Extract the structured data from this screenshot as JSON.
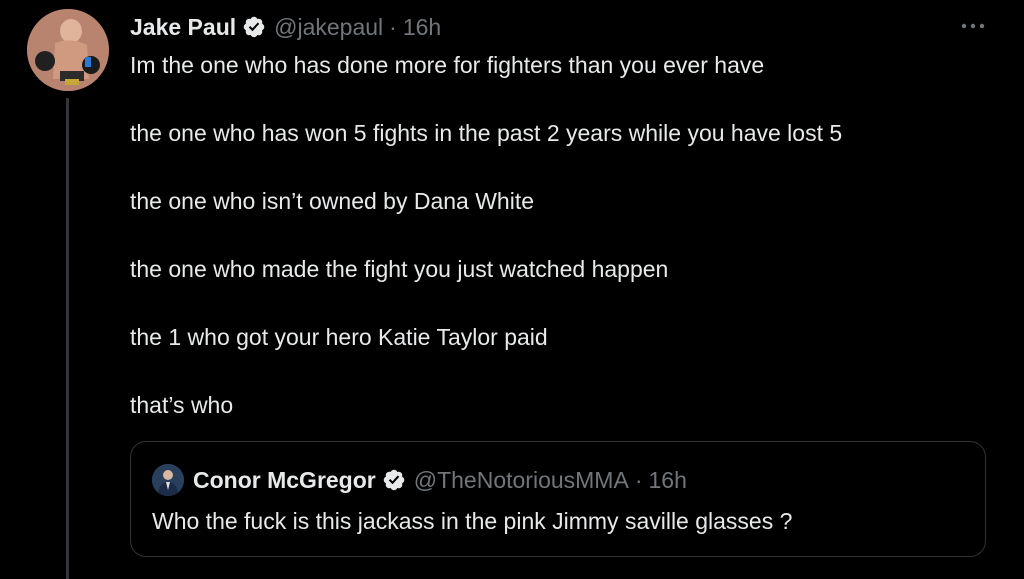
{
  "tweet": {
    "author": {
      "name": "Jake Paul",
      "handle": "@jakepaul",
      "separator": "·",
      "time": "16h",
      "avatar_icon": "profile-photo-boxer",
      "verified_icon": "verified-badge-icon"
    },
    "more_icon": "more-options-icon",
    "lines": [
      "Im the one who has done more for fighters than you ever have",
      "the one who has won 5 fights in the past 2 years while you have lost 5",
      "the one who isn’t owned by Dana White",
      "the one who made the fight you just watched happen",
      "the 1 who got your hero Katie Taylor paid",
      "that’s who"
    ]
  },
  "quote": {
    "author": {
      "name": "Conor McGregor",
      "handle": "@TheNotoriousMMA",
      "separator": "·",
      "time": "16h",
      "avatar_icon": "profile-photo-suit",
      "verified_icon": "verified-badge-icon"
    },
    "text": "Who the fuck is this jackass in the pink Jimmy saville glasses ?"
  },
  "colors": {
    "background": "#000000",
    "primary_text": "#e7e9ea",
    "secondary_text": "#71767b",
    "border": "#2f3336",
    "thread_line": "#333639"
  }
}
